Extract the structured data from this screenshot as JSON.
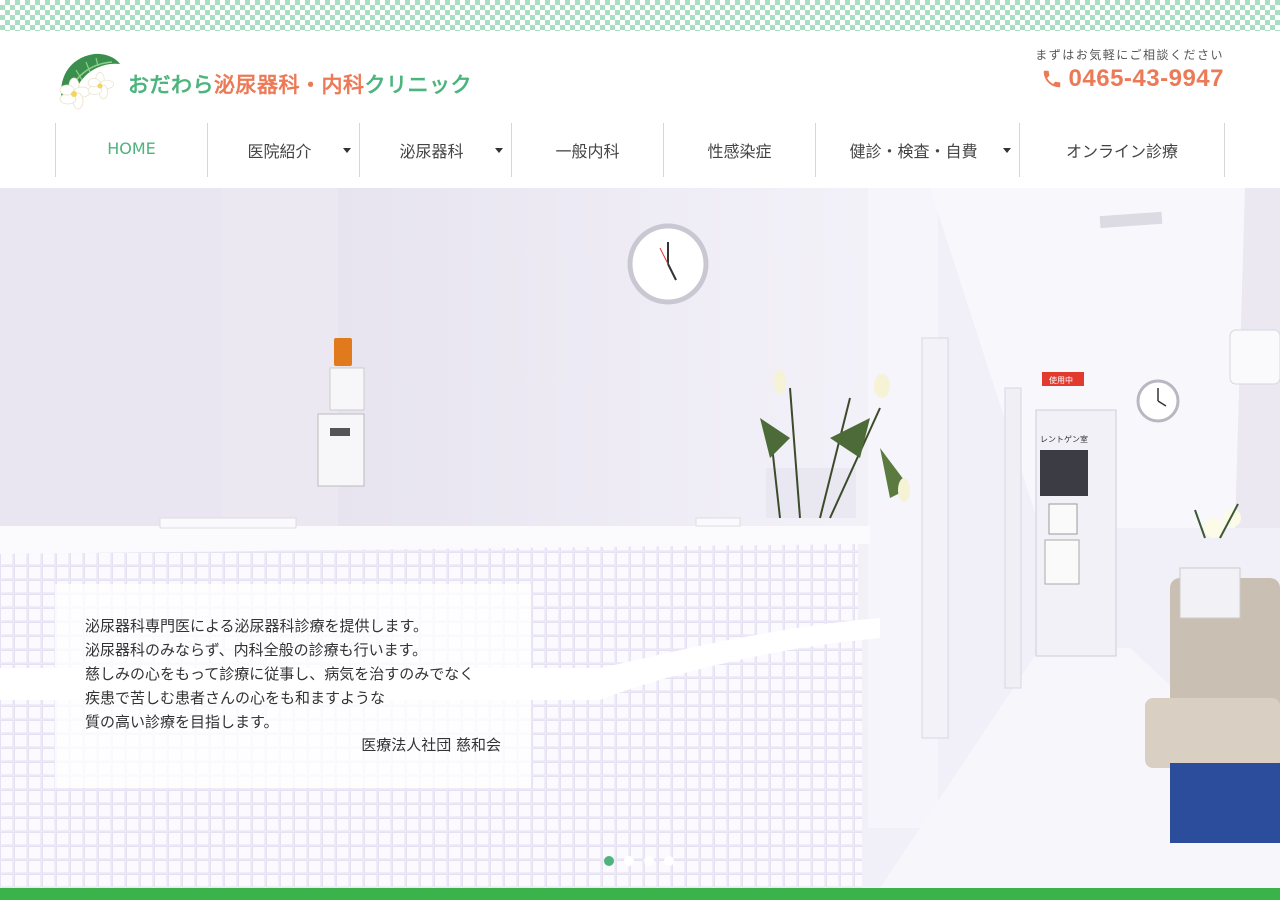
{
  "header": {
    "logo_text_part1": "おだわら",
    "logo_text_part2": "泌尿器科・内科",
    "logo_text_part3": "クリニック",
    "contact_lead": "まずはお気軽にご相談ください",
    "phone": "0465-43-9947"
  },
  "nav": {
    "items": [
      {
        "label": "HOME",
        "active": true,
        "has_submenu": false
      },
      {
        "label": "医院紹介",
        "active": false,
        "has_submenu": true
      },
      {
        "label": "泌尿器科",
        "active": false,
        "has_submenu": true
      },
      {
        "label": "一般内科",
        "active": false,
        "has_submenu": false
      },
      {
        "label": "性感染症",
        "active": false,
        "has_submenu": false
      },
      {
        "label": "健診・検査・自費",
        "active": false,
        "has_submenu": true
      },
      {
        "label": "オンライン診療",
        "active": false,
        "has_submenu": false
      }
    ]
  },
  "hero": {
    "message_lines": [
      "泌尿器科専門医による泌尿器科診療を提供します。",
      "泌尿器科のみならず、内科全般の診療も行います。",
      "慈しみの心をもって診療に従事し、病気を治すのみでなく",
      "疾患で苦しむ患者さんの心をも和ますような",
      "質の高い診療を目指します。"
    ],
    "signature": "医療法人社団 慈和会",
    "sign_in_use": "使用中",
    "sign_xray": "レントゲン室",
    "slides_total": 4,
    "active_slide": 1
  },
  "colors": {
    "brand_green": "#4cb47c",
    "accent_orange": "#ec7a57",
    "band_green": "#3ab44a"
  }
}
